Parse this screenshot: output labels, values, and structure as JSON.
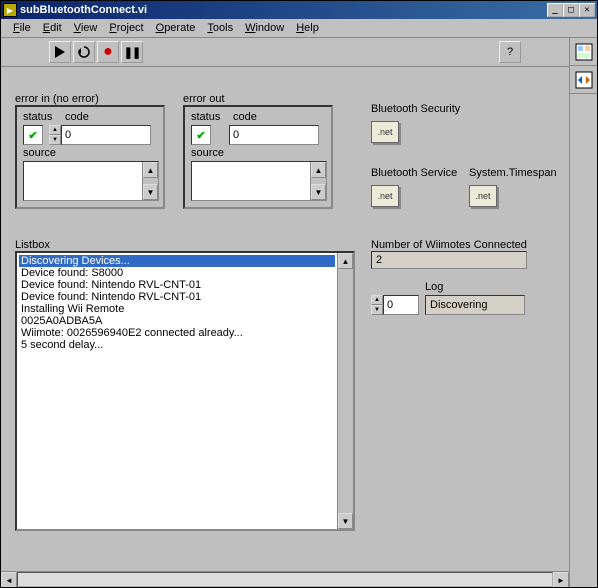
{
  "window": {
    "title": "subBluetoothConnect.vi"
  },
  "menu": {
    "file": "File",
    "edit": "Edit",
    "view": "View",
    "project": "Project",
    "operate": "Operate",
    "tools": "Tools",
    "window": "Window",
    "help": "Help"
  },
  "errorIn": {
    "label": "error in (no error)",
    "statusLabel": "status",
    "codeLabel": "code",
    "sourceLabel": "source",
    "status": "✔",
    "code": "0",
    "source": ""
  },
  "errorOut": {
    "label": "error out",
    "statusLabel": "status",
    "codeLabel": "code",
    "sourceLabel": "source",
    "status": "✔",
    "code": "0",
    "source": ""
  },
  "refs": {
    "btSecurity": {
      "label": "Bluetooth Security",
      "text": ".net"
    },
    "btService": {
      "label": "Bluetooth Service",
      "text": ".net"
    },
    "timespan": {
      "label": "System.Timespan",
      "text": ".net"
    }
  },
  "listbox": {
    "label": "Listbox",
    "items": [
      "Discovering Devices...",
      "Device found: S8000",
      "Device found: Nintendo RVL-CNT-01",
      "Device found: Nintendo RVL-CNT-01",
      "Installing Wii Remote",
      "0025A0ADBA5A",
      "Wiimote: 0026596940E2 connected already...",
      "5 second delay..."
    ],
    "selectedIndex": 0
  },
  "wiimotes": {
    "label": "Number of Wiimotes Connected",
    "value": "2"
  },
  "log": {
    "label": "Log",
    "index": "0",
    "value": "Discovering"
  },
  "helpTip": "?"
}
